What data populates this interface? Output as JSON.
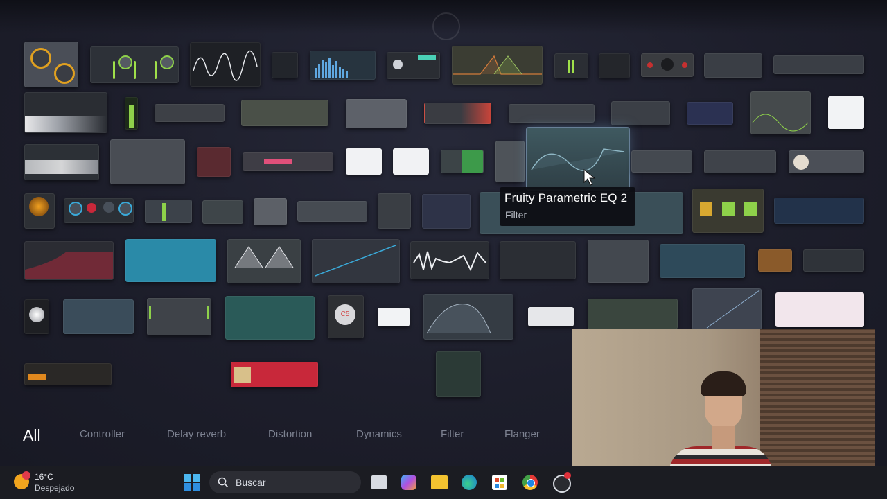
{
  "tooltip": {
    "title": "Fruity Parametric EQ 2",
    "category": "Filter"
  },
  "categories": {
    "all": "All",
    "controller": "Controller",
    "delay_reverb": "Delay reverb",
    "distortion": "Distortion",
    "dynamics": "Dynamics",
    "filter": "Filter",
    "flanger": "Flanger"
  },
  "taskbar": {
    "weather": {
      "temperature": "16°C",
      "condition": "Despejado"
    },
    "search_label": "Buscar",
    "icons": [
      "start-icon",
      "search-icon",
      "task-view-icon",
      "copilot-icon",
      "file-explorer-icon",
      "edge-icon",
      "store-icon",
      "chrome-icon",
      "obs-icon"
    ]
  },
  "plugins": {
    "labels": [
      "C5"
    ]
  },
  "colors": {
    "background": "#1c1d29",
    "tooltip_bg": "#0c0d12",
    "tab_active": "#ffffff",
    "tab_inactive": "#7d8291",
    "accent_green": "#8ed14a",
    "accent_blue": "#3aa9d8",
    "accent_red": "#c8283a"
  }
}
